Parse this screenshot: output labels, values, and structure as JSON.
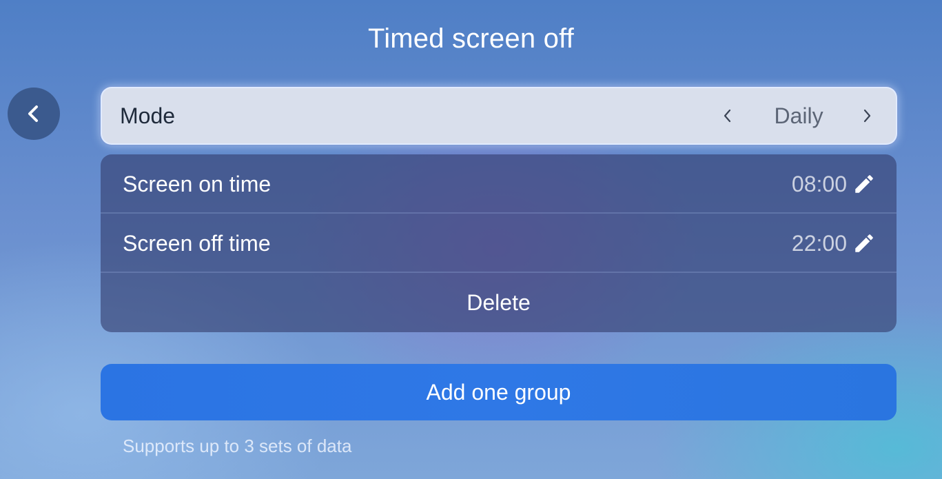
{
  "header": {
    "title": "Timed screen off",
    "back_icon": "chevron-left-icon"
  },
  "mode": {
    "label": "Mode",
    "value": "Daily",
    "prev_icon": "chevron-left-icon",
    "next_icon": "chevron-right-icon"
  },
  "group": {
    "screen_on": {
      "label": "Screen on time",
      "value": "08:00",
      "icon": "pencil-icon"
    },
    "screen_off": {
      "label": "Screen off time",
      "value": "22:00",
      "icon": "pencil-icon"
    },
    "delete_label": "Delete"
  },
  "actions": {
    "add_label": "Add one group"
  },
  "footer": {
    "hint": "Supports up to 3 sets of data"
  },
  "colors": {
    "accent": "#2b74e3",
    "mode_row_bg": "#d9dfec",
    "card_bg": "#343e6e",
    "back_button_bg": "#3b5a8e"
  }
}
